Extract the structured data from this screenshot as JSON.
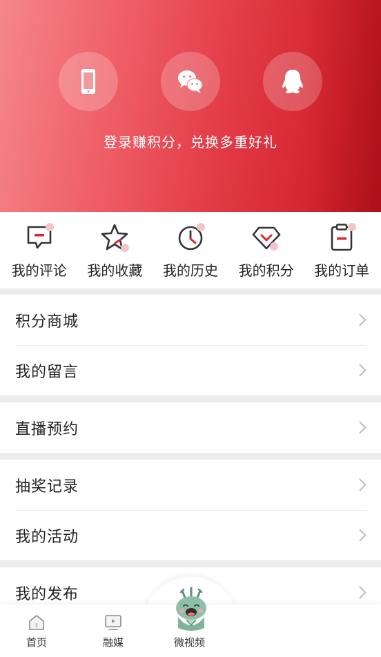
{
  "header": {
    "login_options": [
      {
        "name": "phone",
        "icon": "phone-icon"
      },
      {
        "name": "wechat",
        "icon": "wechat-icon"
      },
      {
        "name": "qq",
        "icon": "qq-icon"
      }
    ],
    "hint": "登录赚积分，兑换多重好礼"
  },
  "quick_actions": [
    {
      "label": "我的评论",
      "icon": "comment-icon"
    },
    {
      "label": "我的收藏",
      "icon": "star-icon"
    },
    {
      "label": "我的历史",
      "icon": "clock-icon"
    },
    {
      "label": "我的积分",
      "icon": "gem-icon"
    },
    {
      "label": "我的订单",
      "icon": "clipboard-icon"
    }
  ],
  "menu": {
    "group1": [
      "积分商城",
      "我的留言"
    ],
    "group2": [
      "直播预约"
    ],
    "group3": [
      "抽奖记录",
      "我的活动"
    ],
    "group4": [
      "我的发布"
    ]
  },
  "tabbar": {
    "tabs": [
      {
        "label": "首页",
        "icon": "home-icon"
      },
      {
        "label": "融媒",
        "icon": "media-icon"
      },
      {
        "label": "微视频",
        "icon": "mascot-icon"
      }
    ]
  },
  "colors": {
    "brand_red": "#d2232e",
    "accent_pink": "#f4c4c8"
  }
}
